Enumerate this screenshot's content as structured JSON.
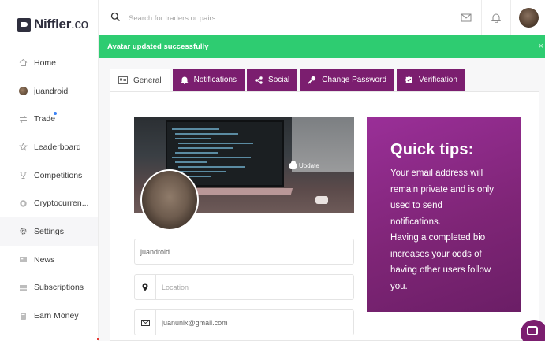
{
  "brand": {
    "name": "Niffler",
    "suffix": ".co"
  },
  "search": {
    "placeholder": "Search for traders or pairs"
  },
  "sidebar": {
    "items": [
      {
        "label": "Home",
        "icon": "home-icon"
      },
      {
        "label": "juandroid",
        "icon": "user-avatar"
      },
      {
        "label": "Trade",
        "icon": "swap-arrows-icon",
        "has_notification": true
      },
      {
        "label": "Leaderboard",
        "icon": "star-icon"
      },
      {
        "label": "Competitions",
        "icon": "trophy-icon"
      },
      {
        "label": "Cryptocurren...",
        "icon": "coin-icon"
      },
      {
        "label": "Settings",
        "icon": "gear-icon",
        "active": true
      },
      {
        "label": "News",
        "icon": "newspaper-icon"
      },
      {
        "label": "Subscriptions",
        "icon": "list-icon"
      },
      {
        "label": "Earn Money",
        "icon": "wallet-icon"
      }
    ]
  },
  "banner": {
    "message": "Avatar updated successfully",
    "close": "×"
  },
  "tabs": [
    {
      "label": "General",
      "icon": "id-card-icon",
      "active": true
    },
    {
      "label": "Notifications",
      "icon": "bell-icon"
    },
    {
      "label": "Social",
      "icon": "share-icon"
    },
    {
      "label": "Change Password",
      "icon": "key-icon"
    },
    {
      "label": "Verification",
      "icon": "badge-icon"
    }
  ],
  "profile": {
    "update_label": "Update",
    "username": "juandroid",
    "location_placeholder": "Location",
    "email": "juanunix@gmail.com"
  },
  "tips": {
    "title": "Quick tips:",
    "lines": [
      "Your email address will",
      "remain private and is only",
      "used to send",
      "notifications.",
      "Having a completed bio",
      "increases your odds of",
      "having other users follow",
      "you."
    ]
  },
  "colors": {
    "accent": "#7b1e6f",
    "success": "#2ecc71",
    "tips_bg": "#8a2a85"
  }
}
